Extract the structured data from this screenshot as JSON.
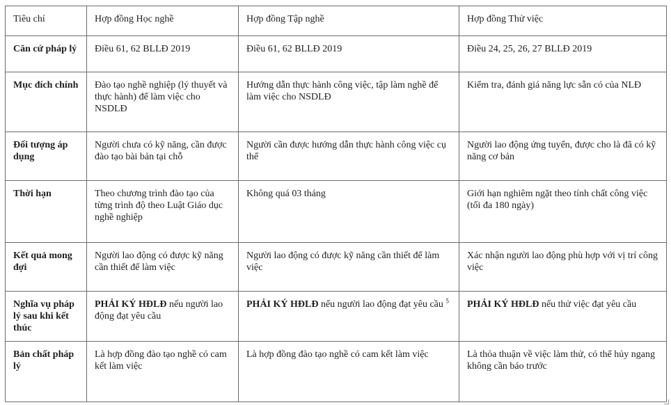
{
  "headers": [
    "Tiêu chí",
    "Hợp đồng Học nghề",
    "Hợp đồng Tập nghề",
    "Hợp đồng Thử việc"
  ],
  "rows": [
    {
      "criterion": "Căn cứ pháp lý",
      "hoc_nghe": "Điều 61, 62 BLLĐ 2019",
      "tap_nghe": "Điều 61, 62 BLLĐ 2019",
      "thu_viec": "Điều 24, 25, 26, 27 BLLĐ 2019"
    },
    {
      "criterion": "Mục đích chính",
      "hoc_nghe": "Đào tạo nghề nghiệp (lý thuyết và thực hành) để làm việc cho NSDLĐ",
      "tap_nghe": "Hướng dẫn thực hành công việc, tập làm nghề để làm việc cho NSDLĐ",
      "thu_viec": "Kiểm tra, đánh giá năng lực sẵn có của NLĐ"
    },
    {
      "criterion": "Đối tượng áp dụng",
      "hoc_nghe": "Người chưa có kỹ năng, cần được đào tạo bài bản tại chỗ",
      "tap_nghe": "Người cần được hướng dẫn thực hành công việc cụ thể",
      "thu_viec": "Người lao động ứng tuyển, được cho là đã có kỹ năng cơ bản"
    },
    {
      "criterion": "Thời hạn",
      "hoc_nghe": "Theo chương trình đào tạo của từng trình độ theo Luật Giáo dục nghề nghiệp",
      "tap_nghe": "Không quá 03 tháng",
      "thu_viec": "Giới hạn nghiêm ngặt theo tính chất công việc (tối đa 180 ngày)"
    },
    {
      "criterion": "Kết quả mong đợi",
      "hoc_nghe": "Người lao động có được kỹ năng cần thiết để làm việc",
      "tap_nghe": "Người lao động có được kỹ năng cần thiết để làm việc",
      "thu_viec": "Xác nhận người lao động phù hợp với vị trí công việc"
    },
    {
      "criterion": "Nghĩa vụ pháp lý sau khi kết thúc",
      "hoc_nghe_bold": "PHẢI KÝ HĐLĐ",
      "hoc_nghe_rest": " nếu người lao động đạt yêu cầu",
      "tap_nghe_bold": "PHẢI KÝ HĐLĐ",
      "tap_nghe_rest": " nếu người lao động đạt yêu cầu ",
      "tap_nghe_footnote": "5",
      "thu_viec_bold": "PHẢI KÝ HĐLĐ",
      "thu_viec_rest": " nếu thử việc đạt yêu cầu"
    },
    {
      "criterion": "Bản chất pháp lý",
      "hoc_nghe": "Là hợp đồng đào tạo nghề có cam kết làm việc",
      "tap_nghe": "Là hợp đồng đào tạo nghề có cam kết làm việc",
      "thu_viec": "Là thỏa thuận về việc làm thử, có thể hủy ngang không cần báo trước"
    }
  ]
}
